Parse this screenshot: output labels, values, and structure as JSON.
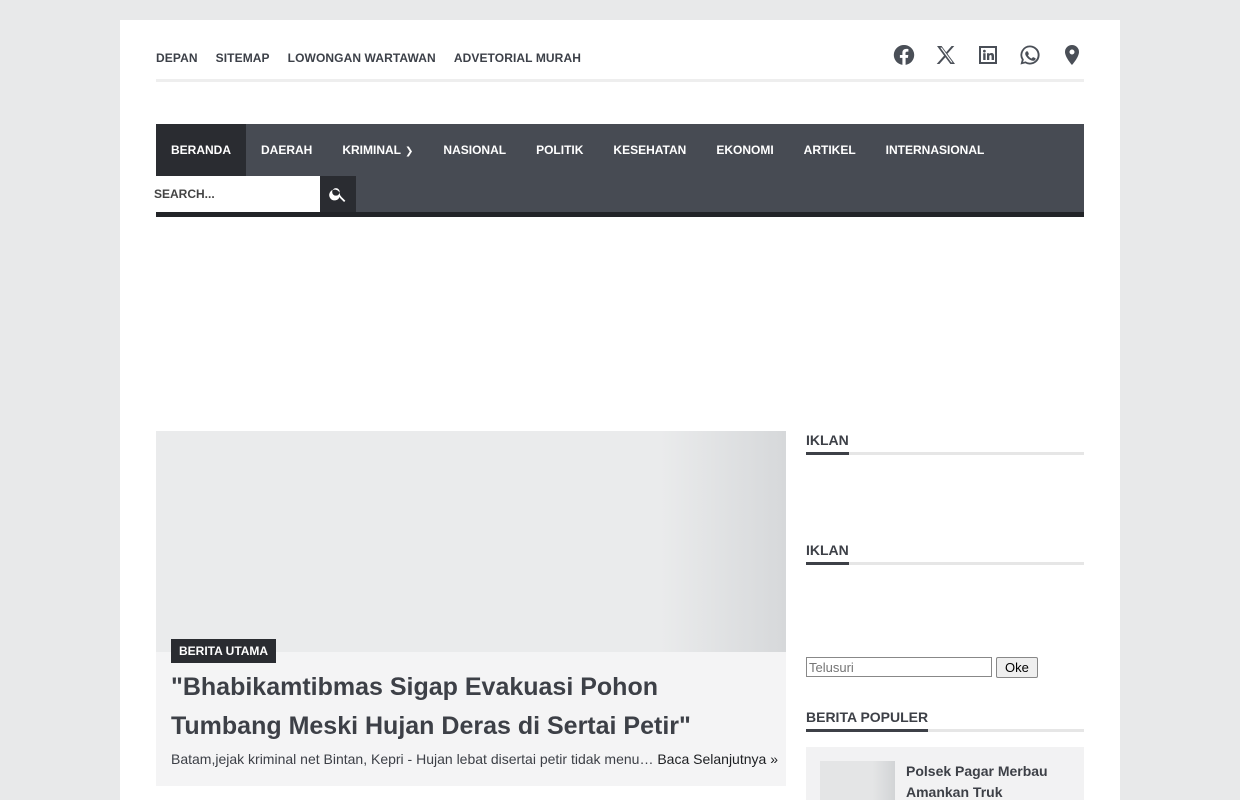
{
  "top_links": [
    "DEPAN",
    "SITEMAP",
    "LOWONGAN WARTAWAN",
    "ADVETORIAL MURAH"
  ],
  "social_icons": [
    "facebook-icon",
    "x-icon",
    "linkedin-icon",
    "whatsapp-icon",
    "map-pin-icon"
  ],
  "nav": {
    "items": [
      "BERANDA",
      "DAERAH",
      "KRIMINAL",
      "NASIONAL",
      "POLITIK",
      "KESEHATAN",
      "EKONOMI",
      "ARTIKEL",
      "INTERNASIONAL"
    ],
    "active": "BERANDA",
    "dropdown_item": "KRIMINAL",
    "search_placeholder": "SEARCH..."
  },
  "featured": {
    "badge": "BERITA UTAMA",
    "headline": "\"Bhabikamtibmas Sigap Evakuasi Pohon Tumbang Meski Hujan Deras di Sertai Petir\"",
    "excerpt": "Batam,jejak kriminal net Bintan, Kepri - Hujan lebat disertai petir tidak menu…",
    "read_more": "Baca Selanjutnya »"
  },
  "sidebar": {
    "ad_title_1": "IKLAN",
    "ad_title_2": "IKLAN",
    "search_placeholder": "Telusuri",
    "search_button": "Oke",
    "popular_title": "BERITA POPULER",
    "popular_first": "Polsek Pagar Merbau Amankan Truk"
  },
  "colors": {
    "page_bg": "#e8e9ea",
    "nav_bg": "#474b53",
    "nav_active": "#2a2c31",
    "text": "#3d4047"
  }
}
